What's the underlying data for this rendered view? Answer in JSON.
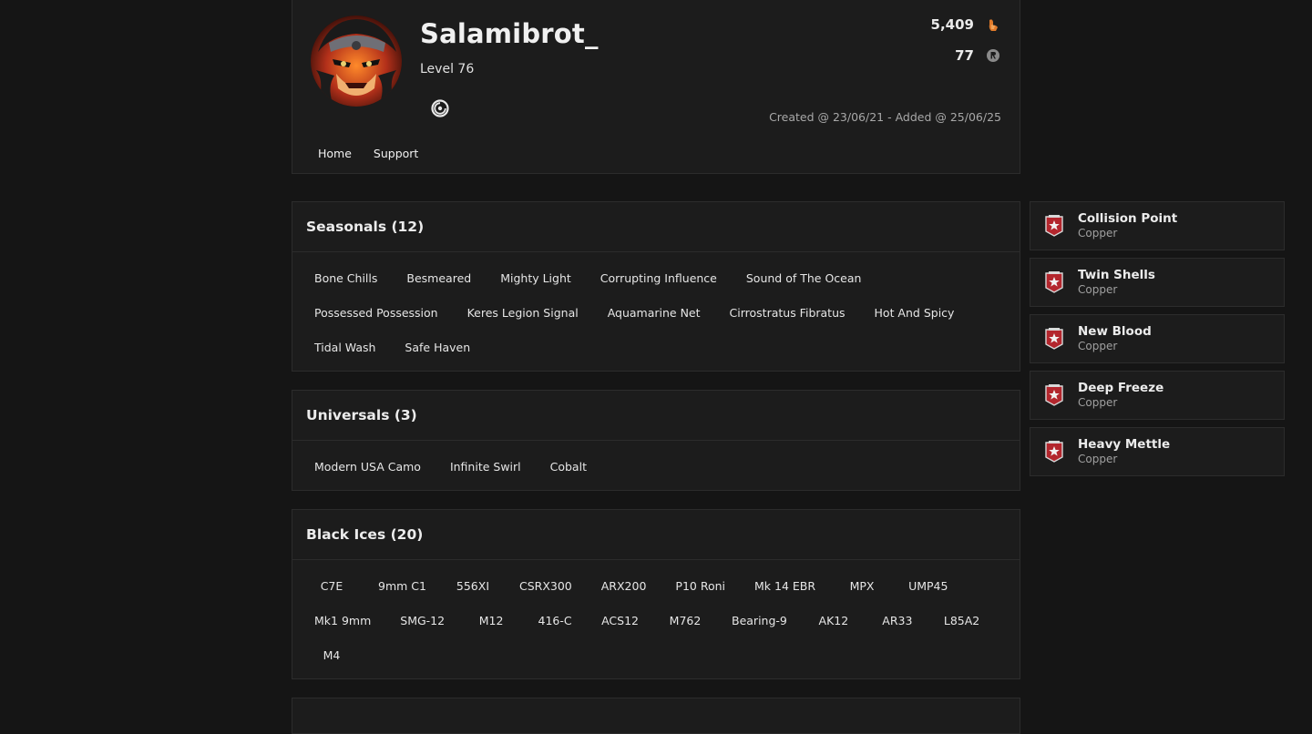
{
  "profile": {
    "username": "Salamibrot_",
    "level": "Level 76",
    "renown": "5,409",
    "credits": "77",
    "created": "Created @ 23/06/21 - Added @ 25/06/25",
    "platform_icon": "ubisoft-icon"
  },
  "nav": {
    "items": [
      "Home",
      "Support"
    ]
  },
  "seasonals": {
    "title": "Seasonals (12)",
    "items": [
      "Bone Chills",
      "Besmeared",
      "Mighty Light",
      "Corrupting Influence",
      "Sound of The Ocean",
      "Possessed Possession",
      "Keres Legion Signal",
      "Aquamarine Net",
      "Cirrostratus Fibratus",
      "Hot And Spicy",
      "Tidal Wash",
      "Safe Haven"
    ]
  },
  "universals": {
    "title": "Universals (3)",
    "items": [
      "Modern USA Camo",
      "Infinite Swirl",
      "Cobalt"
    ]
  },
  "black_ices": {
    "title": "Black Ices (20)",
    "items": [
      "C7E",
      "9mm C1",
      "556XI",
      "CSRX300",
      "ARX200",
      "P10 Roni",
      "Mk 14 EBR",
      "MPX",
      "UMP45",
      "Mk1 9mm",
      "SMG-12",
      "M12",
      "416-C",
      "ACS12",
      "M762",
      "Bearing-9",
      "AK12",
      "AR33",
      "L85A2",
      "M4"
    ]
  },
  "sidebar": {
    "items": [
      {
        "title": "Collision Point",
        "sub": "Copper"
      },
      {
        "title": "Twin Shells",
        "sub": "Copper"
      },
      {
        "title": "New Blood",
        "sub": "Copper"
      },
      {
        "title": "Deep Freeze",
        "sub": "Copper"
      },
      {
        "title": "Heavy Mettle",
        "sub": "Copper"
      }
    ]
  },
  "colors": {
    "background": "#151515",
    "card": "#1c1c1c",
    "border": "#2c2c2c",
    "rank_copper_red": "#b3262d"
  }
}
